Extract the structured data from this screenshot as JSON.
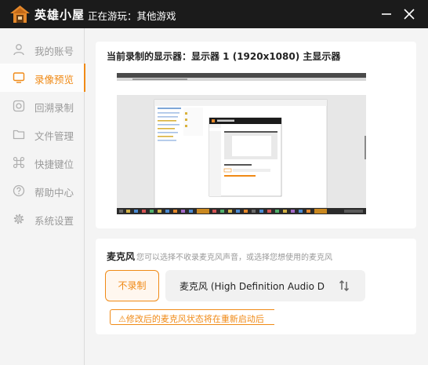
{
  "titlebar": {
    "app_name": "英雄小屋",
    "game_status": "正在游玩：其他游戏"
  },
  "sidebar": {
    "items": [
      {
        "label": "我的账号",
        "icon": "user-icon",
        "active": false
      },
      {
        "label": "录像预览",
        "icon": "monitor-icon",
        "active": true
      },
      {
        "label": "回溯录制",
        "icon": "camera-icon",
        "active": false
      },
      {
        "label": "文件管理",
        "icon": "folder-icon",
        "active": false
      },
      {
        "label": "快捷键位",
        "icon": "command-key-icon",
        "active": false
      },
      {
        "label": "帮助中心",
        "icon": "help-icon",
        "active": false
      },
      {
        "label": "系统设置",
        "icon": "gear-icon",
        "active": false
      }
    ]
  },
  "display": {
    "title": "当前录制的显示器：显示器 1 (1920x1080) 主显示器"
  },
  "mic": {
    "title": "麦克风",
    "hint": "您可以选择不收录麦克风声音，或选择您想使用的麦克风",
    "no_record_label": "不录制",
    "selected_device": "麦克风 (High Definition Audio D...",
    "warning": "⚠修改后的麦克风状态将在重新启动后"
  },
  "colors": {
    "accent": "#f08a16",
    "titlebar": "#1b1b1b"
  }
}
